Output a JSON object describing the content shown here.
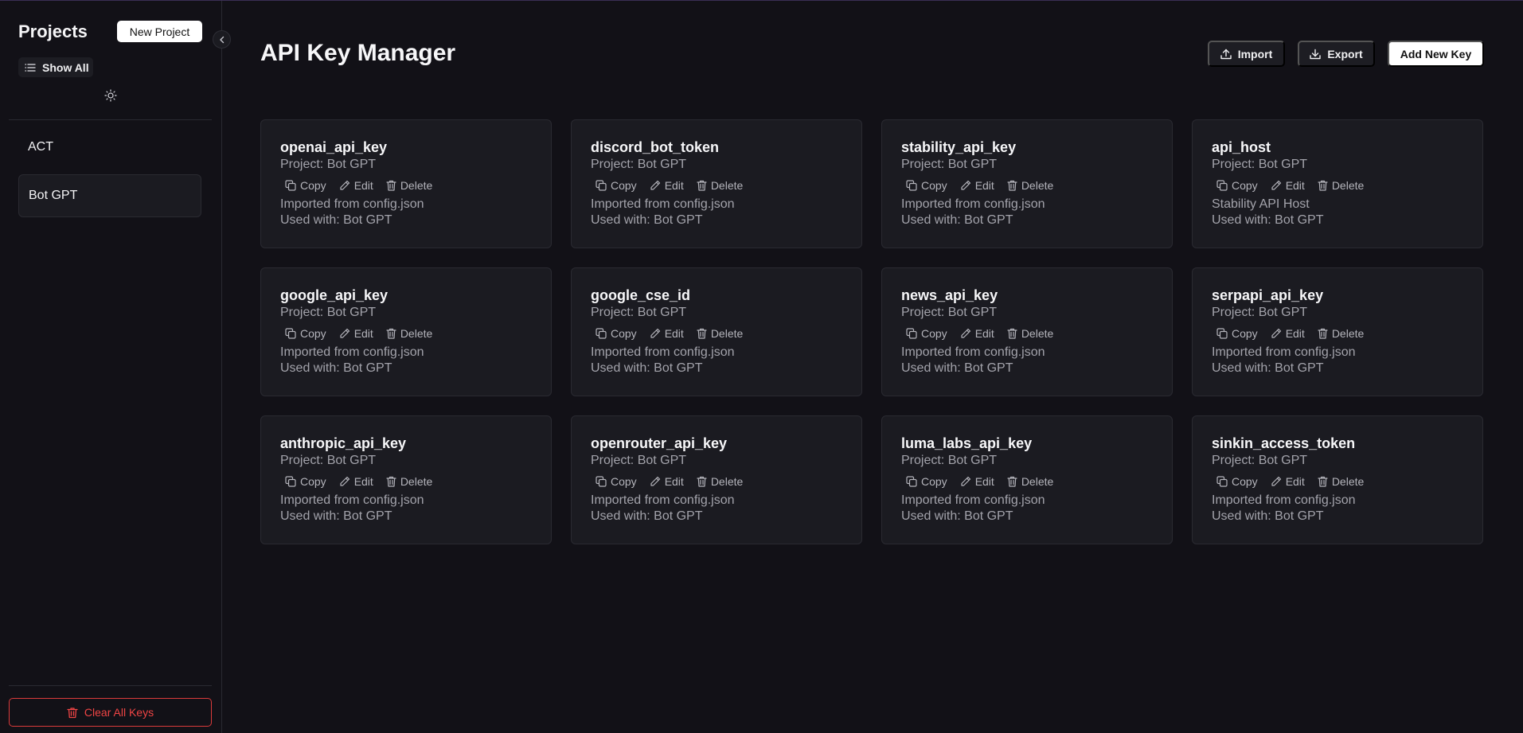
{
  "sidebar": {
    "title": "Projects",
    "new_project_label": "New Project",
    "show_all_label": "Show All",
    "projects": [
      {
        "name": "ACT"
      },
      {
        "name": "Bot GPT"
      }
    ],
    "clear_label": "Clear All Keys",
    "icons": {
      "collapse": "chevron-left-icon",
      "show_all": "list-icon",
      "theme": "sun-icon",
      "clear": "trash-icon"
    }
  },
  "header": {
    "title": "API Key Manager",
    "import_label": "Import",
    "export_label": "Export",
    "add_label": "Add New Key"
  },
  "actions": {
    "copy": "Copy",
    "edit": "Edit",
    "delete": "Delete"
  },
  "keys": [
    {
      "name": "openai_api_key",
      "project": "Project: Bot GPT",
      "description": "Imported from config.json",
      "used": "Used with: Bot GPT"
    },
    {
      "name": "discord_bot_token",
      "project": "Project: Bot GPT",
      "description": "Imported from config.json",
      "used": "Used with: Bot GPT"
    },
    {
      "name": "stability_api_key",
      "project": "Project: Bot GPT",
      "description": "Imported from config.json",
      "used": "Used with: Bot GPT"
    },
    {
      "name": "api_host",
      "project": "Project: Bot GPT",
      "description": "Stability API Host",
      "used": "Used with: Bot GPT"
    },
    {
      "name": "google_api_key",
      "project": "Project: Bot GPT",
      "description": "Imported from config.json",
      "used": "Used with: Bot GPT"
    },
    {
      "name": "google_cse_id",
      "project": "Project: Bot GPT",
      "description": "Imported from config.json",
      "used": "Used with: Bot GPT"
    },
    {
      "name": "news_api_key",
      "project": "Project: Bot GPT",
      "description": "Imported from config.json",
      "used": "Used with: Bot GPT"
    },
    {
      "name": "serpapi_api_key",
      "project": "Project: Bot GPT",
      "description": "Imported from config.json",
      "used": "Used with: Bot GPT"
    },
    {
      "name": "anthropic_api_key",
      "project": "Project: Bot GPT",
      "description": "Imported from config.json",
      "used": "Used with: Bot GPT"
    },
    {
      "name": "openrouter_api_key",
      "project": "Project: Bot GPT",
      "description": "Imported from config.json",
      "used": "Used with: Bot GPT"
    },
    {
      "name": "luma_labs_api_key",
      "project": "Project: Bot GPT",
      "description": "Imported from config.json",
      "used": "Used with: Bot GPT"
    },
    {
      "name": "sinkin_access_token",
      "project": "Project: Bot GPT",
      "description": "Imported from config.json",
      "used": "Used with: Bot GPT"
    }
  ],
  "colors": {
    "background": "#121117",
    "card": "#1b1b21",
    "danger": "#ef4444",
    "primary_button": "#ffffff"
  }
}
